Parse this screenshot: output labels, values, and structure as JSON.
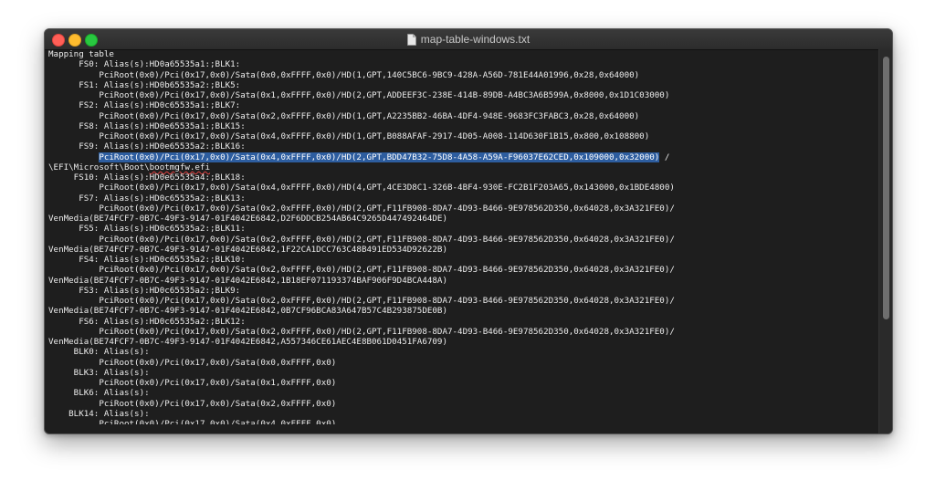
{
  "window": {
    "title": "map-table-windows.txt",
    "scroll_position": 0
  },
  "lines": [
    "Mapping table",
    "      FS0: Alias(s):HD0a65535a1:;BLK1:",
    "          PciRoot(0x0)/Pci(0x17,0x0)/Sata(0x0,0xFFFF,0x0)/HD(1,GPT,140C5BC6-9BC9-428A-A56D-781E44A01996,0x28,0x64000)",
    "      FS1: Alias(s):HD0b65535a2:;BLK5:",
    "          PciRoot(0x0)/Pci(0x17,0x0)/Sata(0x1,0xFFFF,0x0)/HD(2,GPT,ADDEEF3C-238E-414B-89DB-A4BC3A6B599A,0x8000,0x1D1C03000)",
    "      FS2: Alias(s):HD0c65535a1:;BLK7:",
    "          PciRoot(0x0)/Pci(0x17,0x0)/Sata(0x2,0xFFFF,0x0)/HD(1,GPT,A2235BB2-46BA-4DF4-948E-9683FC3FABC3,0x28,0x64000)",
    "      FS8: Alias(s):HD0e65535a1:;BLK15:",
    "          PciRoot(0x0)/Pci(0x17,0x0)/Sata(0x4,0xFFFF,0x0)/HD(1,GPT,B088AFAF-2917-4D05-A008-114D630F1B15,0x800,0x108800)",
    "      FS9: Alias(s):HD0e65535a2:;BLK16:",
    "",
    "",
    "     FS10: Alias(s):HD0e65535a4:;BLK18:",
    "          PciRoot(0x0)/Pci(0x17,0x0)/Sata(0x4,0xFFFF,0x0)/HD(4,GPT,4CE3D8C1-326B-4BF4-930E-FC2B1F203A65,0x143000,0x1BDE4800)",
    "      FS7: Alias(s):HD0c65535a2:;BLK13:",
    "          PciRoot(0x0)/Pci(0x17,0x0)/Sata(0x2,0xFFFF,0x0)/HD(2,GPT,F11FB908-8DA7-4D93-B466-9E978562D350,0x64028,0x3A321FE0)/",
    "VenMedia(BE74FCF7-0B7C-49F3-9147-01F4042E6842,D2F6DDCB254AB64C9265D447492464DE)",
    "      FS5: Alias(s):HD0c65535a2:;BLK11:",
    "          PciRoot(0x0)/Pci(0x17,0x0)/Sata(0x2,0xFFFF,0x0)/HD(2,GPT,F11FB908-8DA7-4D93-B466-9E978562D350,0x64028,0x3A321FE0)/",
    "VenMedia(BE74FCF7-0B7C-49F3-9147-01F4042E6842,1F22CA1DCC763C48B491ED534D92622B)",
    "      FS4: Alias(s):HD0c65535a2:;BLK10:",
    "          PciRoot(0x0)/Pci(0x17,0x0)/Sata(0x2,0xFFFF,0x0)/HD(2,GPT,F11FB908-8DA7-4D93-B466-9E978562D350,0x64028,0x3A321FE0)/",
    "VenMedia(BE74FCF7-0B7C-49F3-9147-01F4042E6842,1B18EF071193374BAF906F9D4BCA448A)",
    "      FS3: Alias(s):HD0c65535a2:;BLK9:",
    "          PciRoot(0x0)/Pci(0x17,0x0)/Sata(0x2,0xFFFF,0x0)/HD(2,GPT,F11FB908-8DA7-4D93-B466-9E978562D350,0x64028,0x3A321FE0)/",
    "VenMedia(BE74FCF7-0B7C-49F3-9147-01F4042E6842,0B7CF96BCA83A647B57C4B293875DE0B)",
    "      FS6: Alias(s):HD0c65535a2:;BLK12:",
    "          PciRoot(0x0)/Pci(0x17,0x0)/Sata(0x2,0xFFFF,0x0)/HD(2,GPT,F11FB908-8DA7-4D93-B466-9E978562D350,0x64028,0x3A321FE0)/",
    "VenMedia(BE74FCF7-0B7C-49F3-9147-01F4042E6842,A557346CE61AEC4E8B061D0451FA6709)",
    "     BLK0: Alias(s):",
    "          PciRoot(0x0)/Pci(0x17,0x0)/Sata(0x0,0xFFFF,0x0)",
    "     BLK3: Alias(s):",
    "          PciRoot(0x0)/Pci(0x17,0x0)/Sata(0x1,0xFFFF,0x0)",
    "     BLK6: Alias(s):",
    "          PciRoot(0x0)/Pci(0x17,0x0)/Sata(0x2,0xFFFF,0x0)",
    "    BLK14: Alias(s):",
    "          PciRoot(0x0)/Pci(0x17,0x0)/Sata(0x4,0xFFFF,0x0)"
  ],
  "selection_line": {
    "indent": "          ",
    "selected_text": "PciRoot(0x0)/Pci(0x17,0x0)/Sata(0x4,0xFFFF,0x0)/HD(2,GPT,BDD47B32-75D8-4A58-A59A-F96037E62CED,0x109000,0x32000)",
    "trailing_text": " /"
  },
  "efi_line": {
    "path_prefix": "\\EFI\\Microsoft\\Boot\\",
    "misspelled_word": "bootmgfw.efi"
  },
  "colors": {
    "terminal_bg": "#1e1e1e",
    "text": "#ececec",
    "selection": "#2d5d9f"
  }
}
